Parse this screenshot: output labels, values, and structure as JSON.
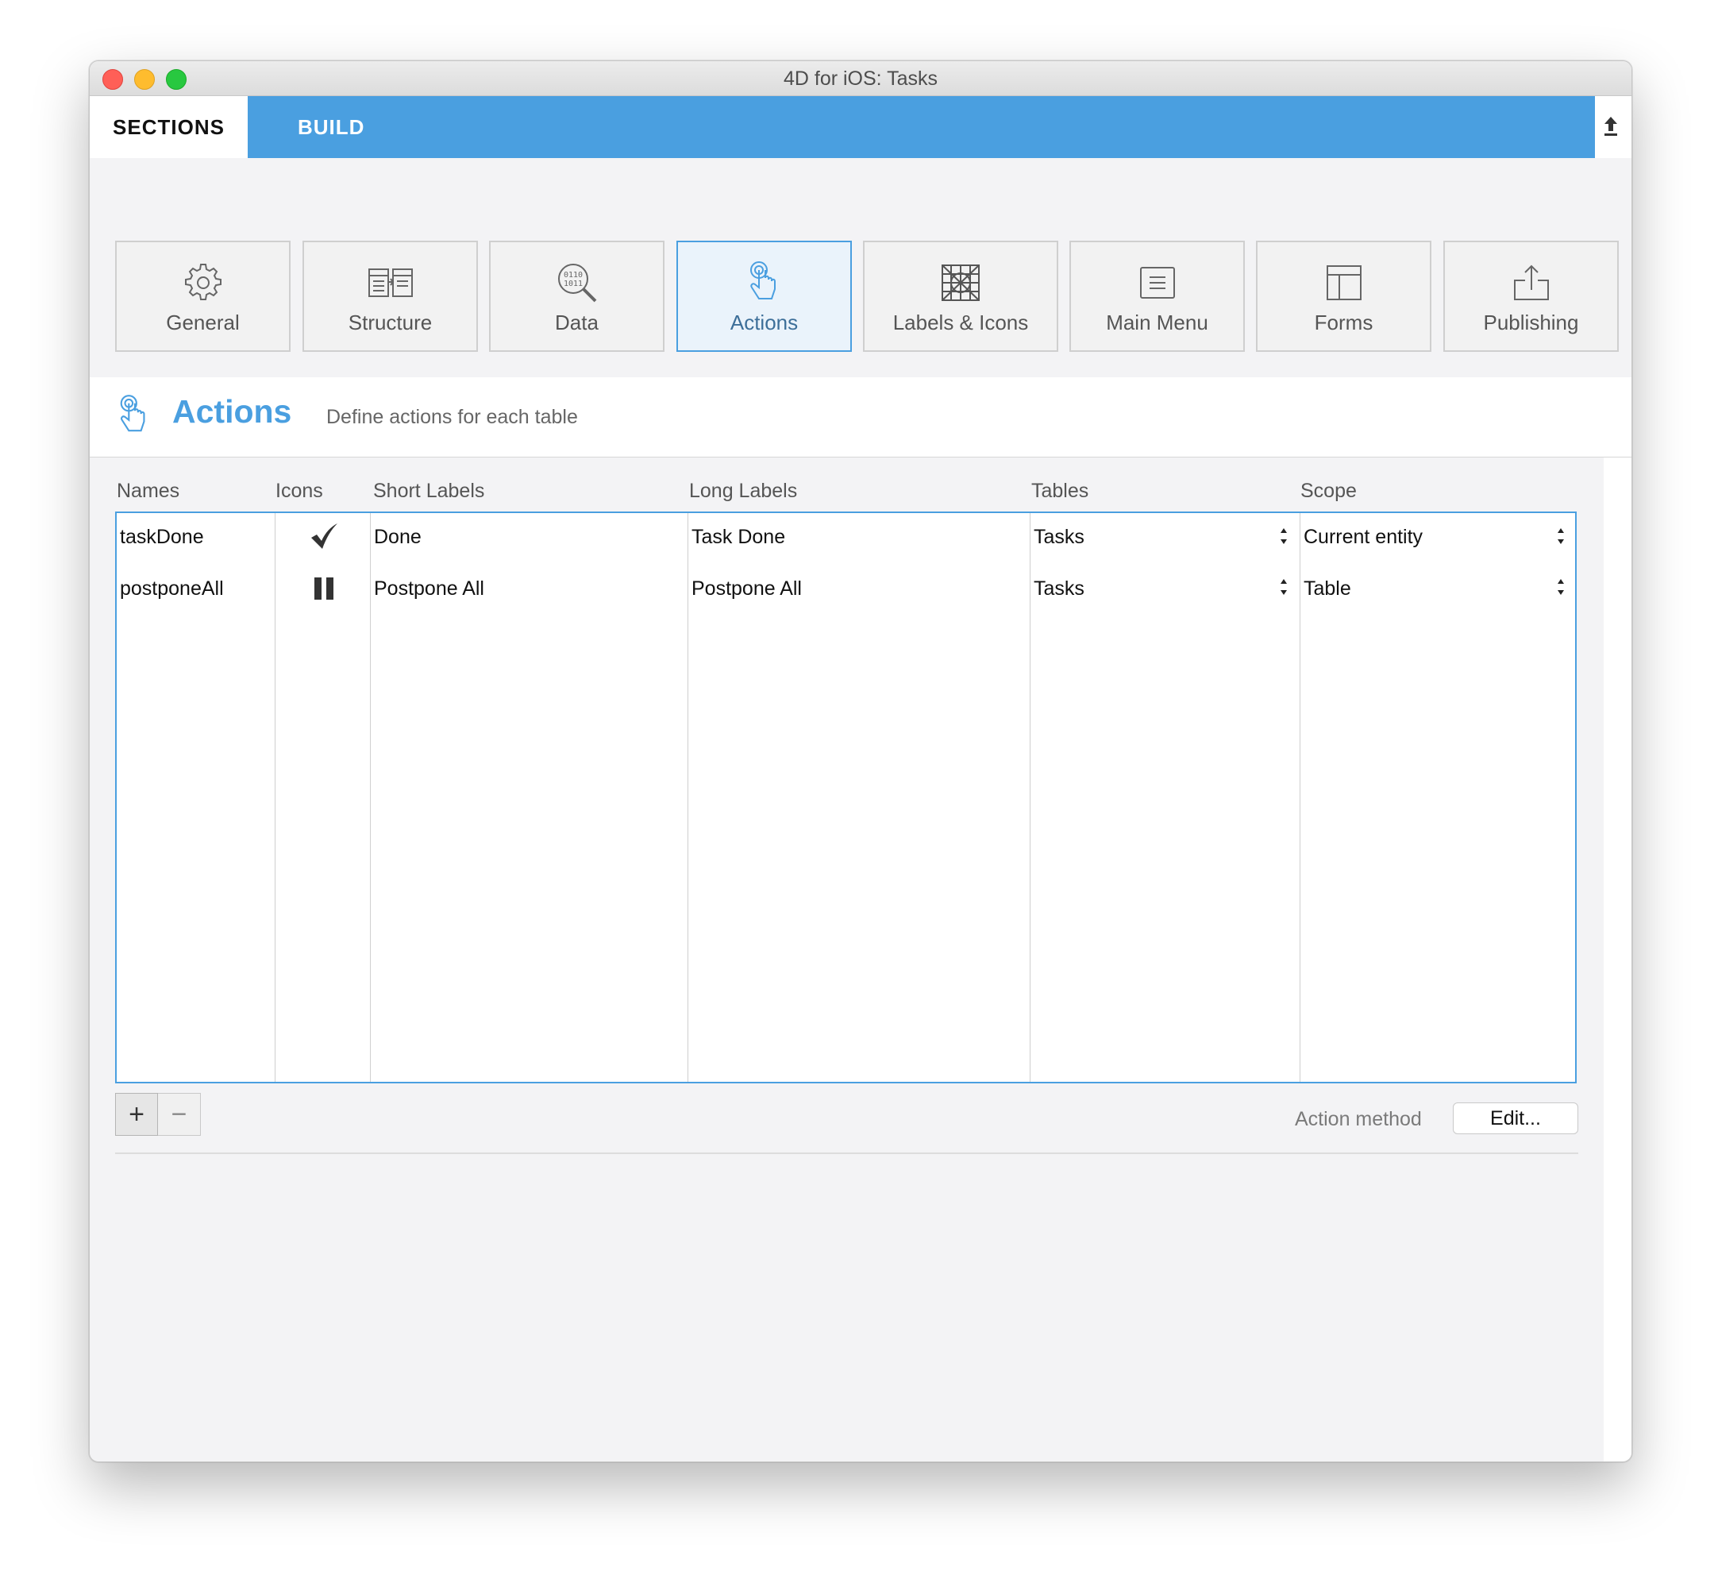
{
  "window": {
    "title": "4D for iOS: Tasks"
  },
  "tabs": {
    "sections": "SECTIONS",
    "build": "BUILD"
  },
  "sections": [
    {
      "label": "General",
      "icon": "gear-icon"
    },
    {
      "label": "Structure",
      "icon": "structure-icon"
    },
    {
      "label": "Data",
      "icon": "data-magnifier-icon"
    },
    {
      "label": "Actions",
      "icon": "touch-hand-icon",
      "selected": true
    },
    {
      "label": "Labels & Icons",
      "icon": "labels-grid-icon"
    },
    {
      "label": "Main Menu",
      "icon": "main-menu-icon"
    },
    {
      "label": "Forms",
      "icon": "forms-layout-icon"
    },
    {
      "label": "Publishing",
      "icon": "publish-upload-icon"
    }
  ],
  "header": {
    "title": "Actions",
    "description": "Define actions for each table"
  },
  "table": {
    "columns": [
      "Names",
      "Icons",
      "Short Labels",
      "Long Labels",
      "Tables",
      "Scope"
    ],
    "rows": [
      {
        "name": "taskDone",
        "icon": "checkmark-icon",
        "short": "Done",
        "long": "Task Done",
        "table": "Tasks",
        "scope": "Current entity"
      },
      {
        "name": "postponeAll",
        "icon": "pause-icon",
        "short": "Postpone All",
        "long": "Postpone All",
        "table": "Tasks",
        "scope": "Table"
      }
    ]
  },
  "footer": {
    "add": "+",
    "remove": "−",
    "action_method_label": "Action method",
    "edit_label": "Edit..."
  },
  "colors": {
    "accent": "#4a9fe0",
    "background": "#f3f3f5"
  }
}
